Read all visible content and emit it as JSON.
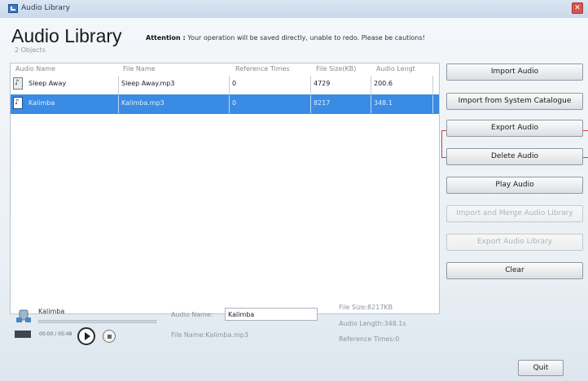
{
  "window": {
    "title": "Audio Library",
    "close_glyph": "✕"
  },
  "header": {
    "title": "Audio Library",
    "attention_label": "Attention :",
    "attention_text": "Your operation will be saved directly, unable to redo. Please be cautions!",
    "object_count": "2 Objects"
  },
  "table": {
    "columns": [
      "Audio Name",
      "File Name",
      "Reference Times",
      "File Size(KB)",
      "Audio Lengt"
    ],
    "rows": [
      {
        "audio_name": "Sleep Away",
        "file_name": "Sleep Away.mp3",
        "reference_times": "0",
        "file_size": "4729",
        "audio_length": "200.6",
        "selected": false
      },
      {
        "audio_name": "Kalimba",
        "file_name": "Kalimba.mp3",
        "reference_times": "0",
        "file_size": "8217",
        "audio_length": "348.1",
        "selected": true
      }
    ]
  },
  "actions": {
    "import_audio": "Import Audio",
    "import_system": "Import from System Catalogue",
    "export_audio": "Export Audio",
    "delete_audio": "Delete Audio",
    "play_audio": "Play Audio",
    "import_merge": "Import and Merge Audio Library",
    "export_library": "Export Audio Library",
    "clear": "Clear"
  },
  "player": {
    "track_name": "Kalimba",
    "time": "00:00 / 05:48",
    "progress": 0
  },
  "details": {
    "audio_name_label": "Audio Name:",
    "audio_name_value": "Kalimba",
    "file_name": "File Name:Kalimba.mp3",
    "file_size": "File Size:8217KB",
    "audio_length": "Audio Length:348.1s",
    "reference_times": "Reference Times:0"
  },
  "footer": {
    "quit_label": "Quit"
  },
  "colors": {
    "selection": "#3a8be3",
    "highlight_border": "#d93a3a"
  }
}
